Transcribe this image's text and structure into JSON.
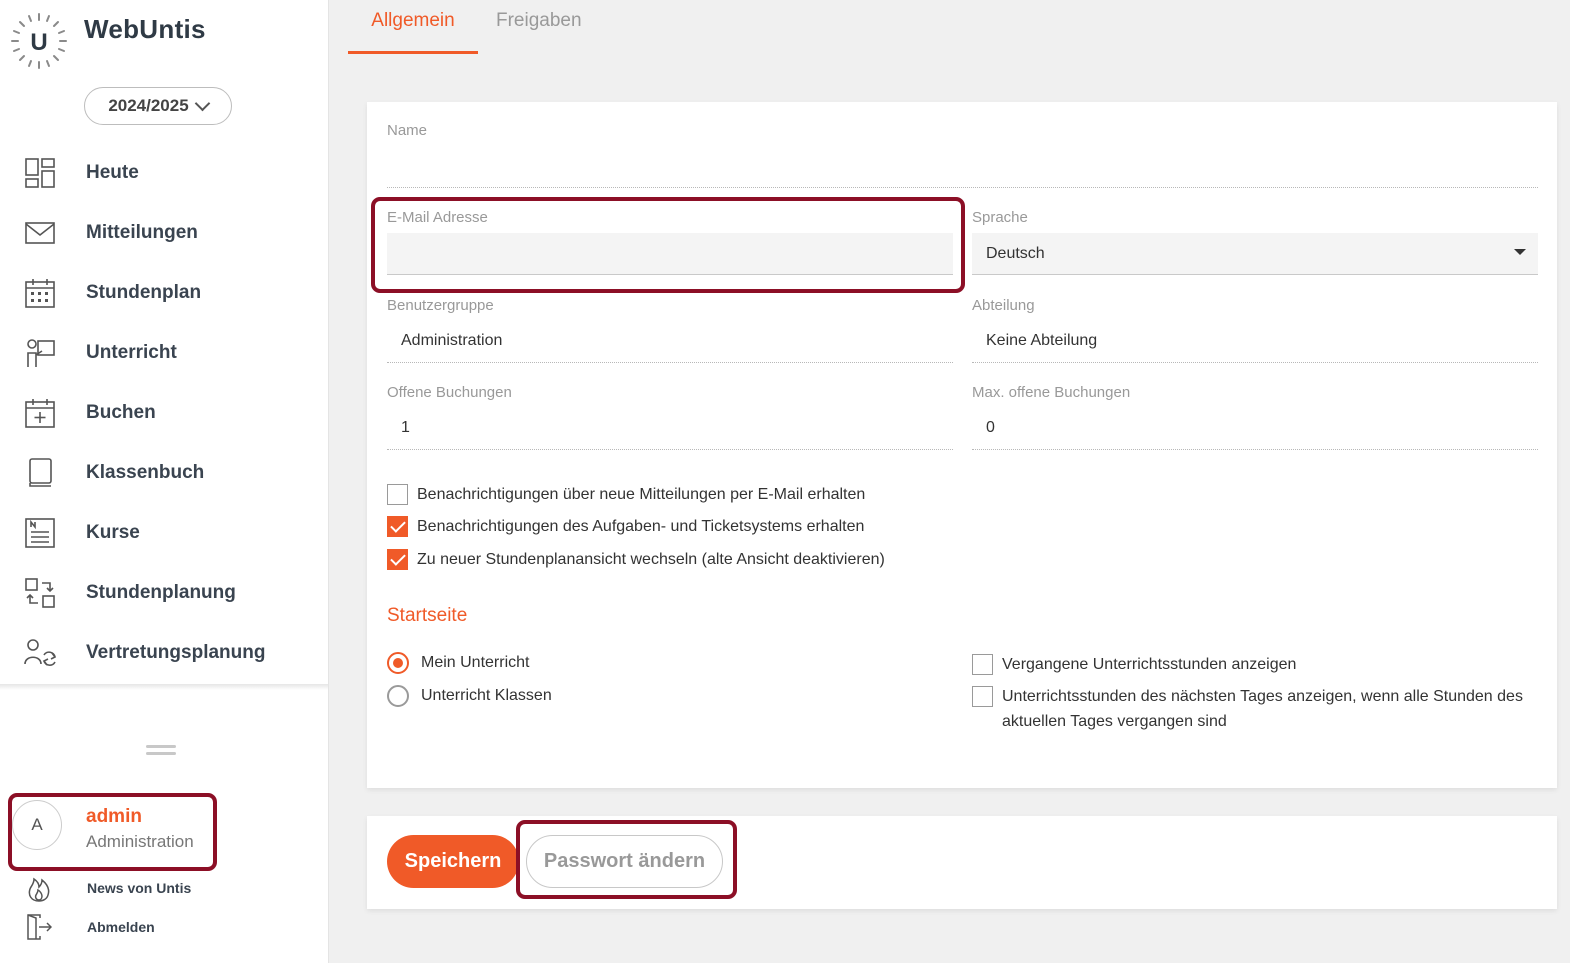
{
  "app": {
    "brand": "WebUntis",
    "logo_letter": "U",
    "school_year": "2024/2025"
  },
  "sidebar": {
    "items": [
      {
        "label": "Heute",
        "icon": "dashboard-icon"
      },
      {
        "label": "Mitteilungen",
        "icon": "envelope-icon"
      },
      {
        "label": "Stundenplan",
        "icon": "calendar-grid-icon"
      },
      {
        "label": "Unterricht",
        "icon": "teacher-board-icon"
      },
      {
        "label": "Buchen",
        "icon": "calendar-plus-icon"
      },
      {
        "label": "Klassenbuch",
        "icon": "book-icon"
      },
      {
        "label": "Kurse",
        "icon": "list-document-icon"
      },
      {
        "label": "Stundenplanung",
        "icon": "schedule-swap-icon"
      },
      {
        "label": "Vertretungsplanung",
        "icon": "substitution-icon"
      }
    ],
    "user": {
      "avatar_letter": "A",
      "name": "admin",
      "role": "Administration"
    },
    "footer_links": [
      {
        "label": "News von Untis",
        "icon": "flame-icon"
      },
      {
        "label": "Abmelden",
        "icon": "logout-door-icon"
      }
    ]
  },
  "tabs": [
    {
      "label": "Allgemein",
      "active": true
    },
    {
      "label": "Freigaben",
      "active": false
    }
  ],
  "form": {
    "name": {
      "label": "Name",
      "value": ""
    },
    "email": {
      "label": "E-Mail Adresse",
      "value": ""
    },
    "language": {
      "label": "Sprache",
      "value": "Deutsch"
    },
    "user_group": {
      "label": "Benutzergruppe",
      "value": "Administration"
    },
    "department": {
      "label": "Abteilung",
      "value": "Keine Abteilung"
    },
    "open_bookings": {
      "label": "Offene Buchungen",
      "value": "1"
    },
    "max_open_bookings": {
      "label": "Max. offene Buchungen",
      "value": "0"
    },
    "checkboxes": [
      {
        "label": "Benachrichtigungen über neue Mitteilungen per E-Mail erhalten",
        "checked": false
      },
      {
        "label": "Benachrichtigungen des Aufgaben- und Ticketsystems erhalten",
        "checked": true
      },
      {
        "label": "Zu neuer Stundenplanansicht wechseln (alte Ansicht deaktivieren)",
        "checked": true
      }
    ],
    "startpage": {
      "title": "Startseite",
      "options": [
        {
          "label": "Mein Unterricht",
          "selected": true
        },
        {
          "label": "Unterricht Klassen",
          "selected": false
        }
      ],
      "checkboxes": [
        {
          "label": "Vergangene Unterrichtsstunden anzeigen",
          "checked": false
        },
        {
          "label": "Unterrichtsstunden des nächsten Tages anzeigen, wenn alle Stunden des aktuellen Tages vergangen sind",
          "checked": false
        }
      ]
    }
  },
  "actions": {
    "save": "Speichern",
    "change_password": "Passwort ändern"
  },
  "colors": {
    "accent": "#f05a28",
    "highlight": "#8c0f26"
  }
}
